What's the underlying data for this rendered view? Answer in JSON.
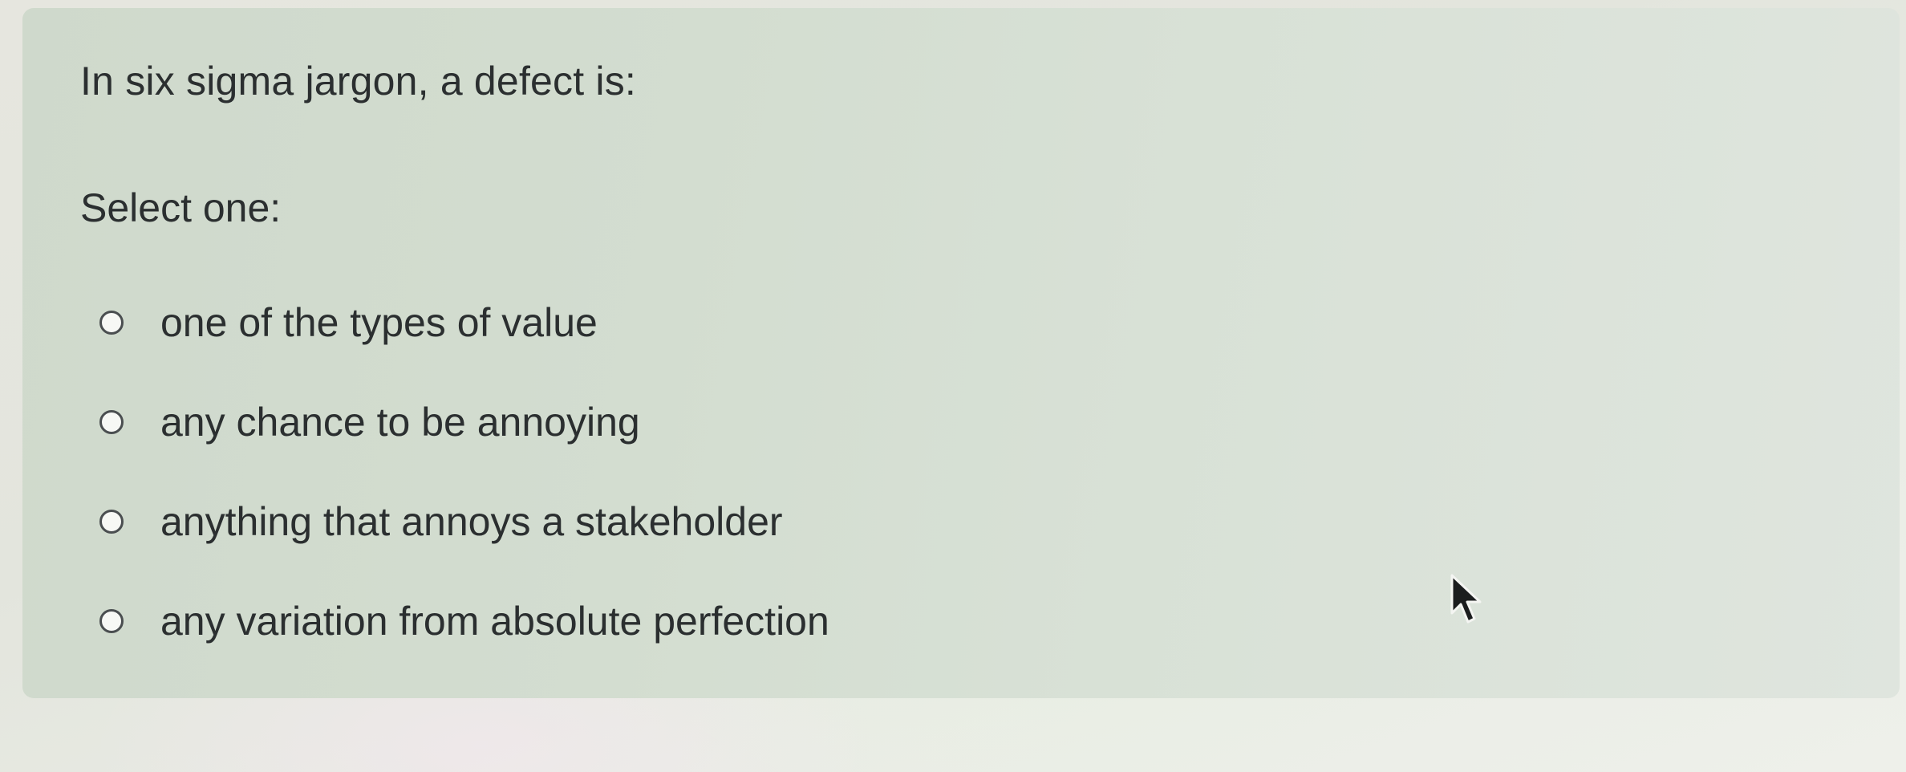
{
  "question": {
    "text": "In six sigma jargon, a defect is:",
    "prompt": "Select one:",
    "options": [
      {
        "label": "one of the types of value"
      },
      {
        "label": "any chance to be annoying"
      },
      {
        "label": "anything that annoys a stakeholder"
      },
      {
        "label": "any variation from absolute perfection"
      }
    ]
  },
  "icons": {
    "cursor": "mouse-pointer-arrow",
    "radio": "radio-unchecked"
  },
  "colors": {
    "card_background": "#d3ddd0",
    "text": "#2b2f30",
    "radio_border": "#4a4e50"
  }
}
